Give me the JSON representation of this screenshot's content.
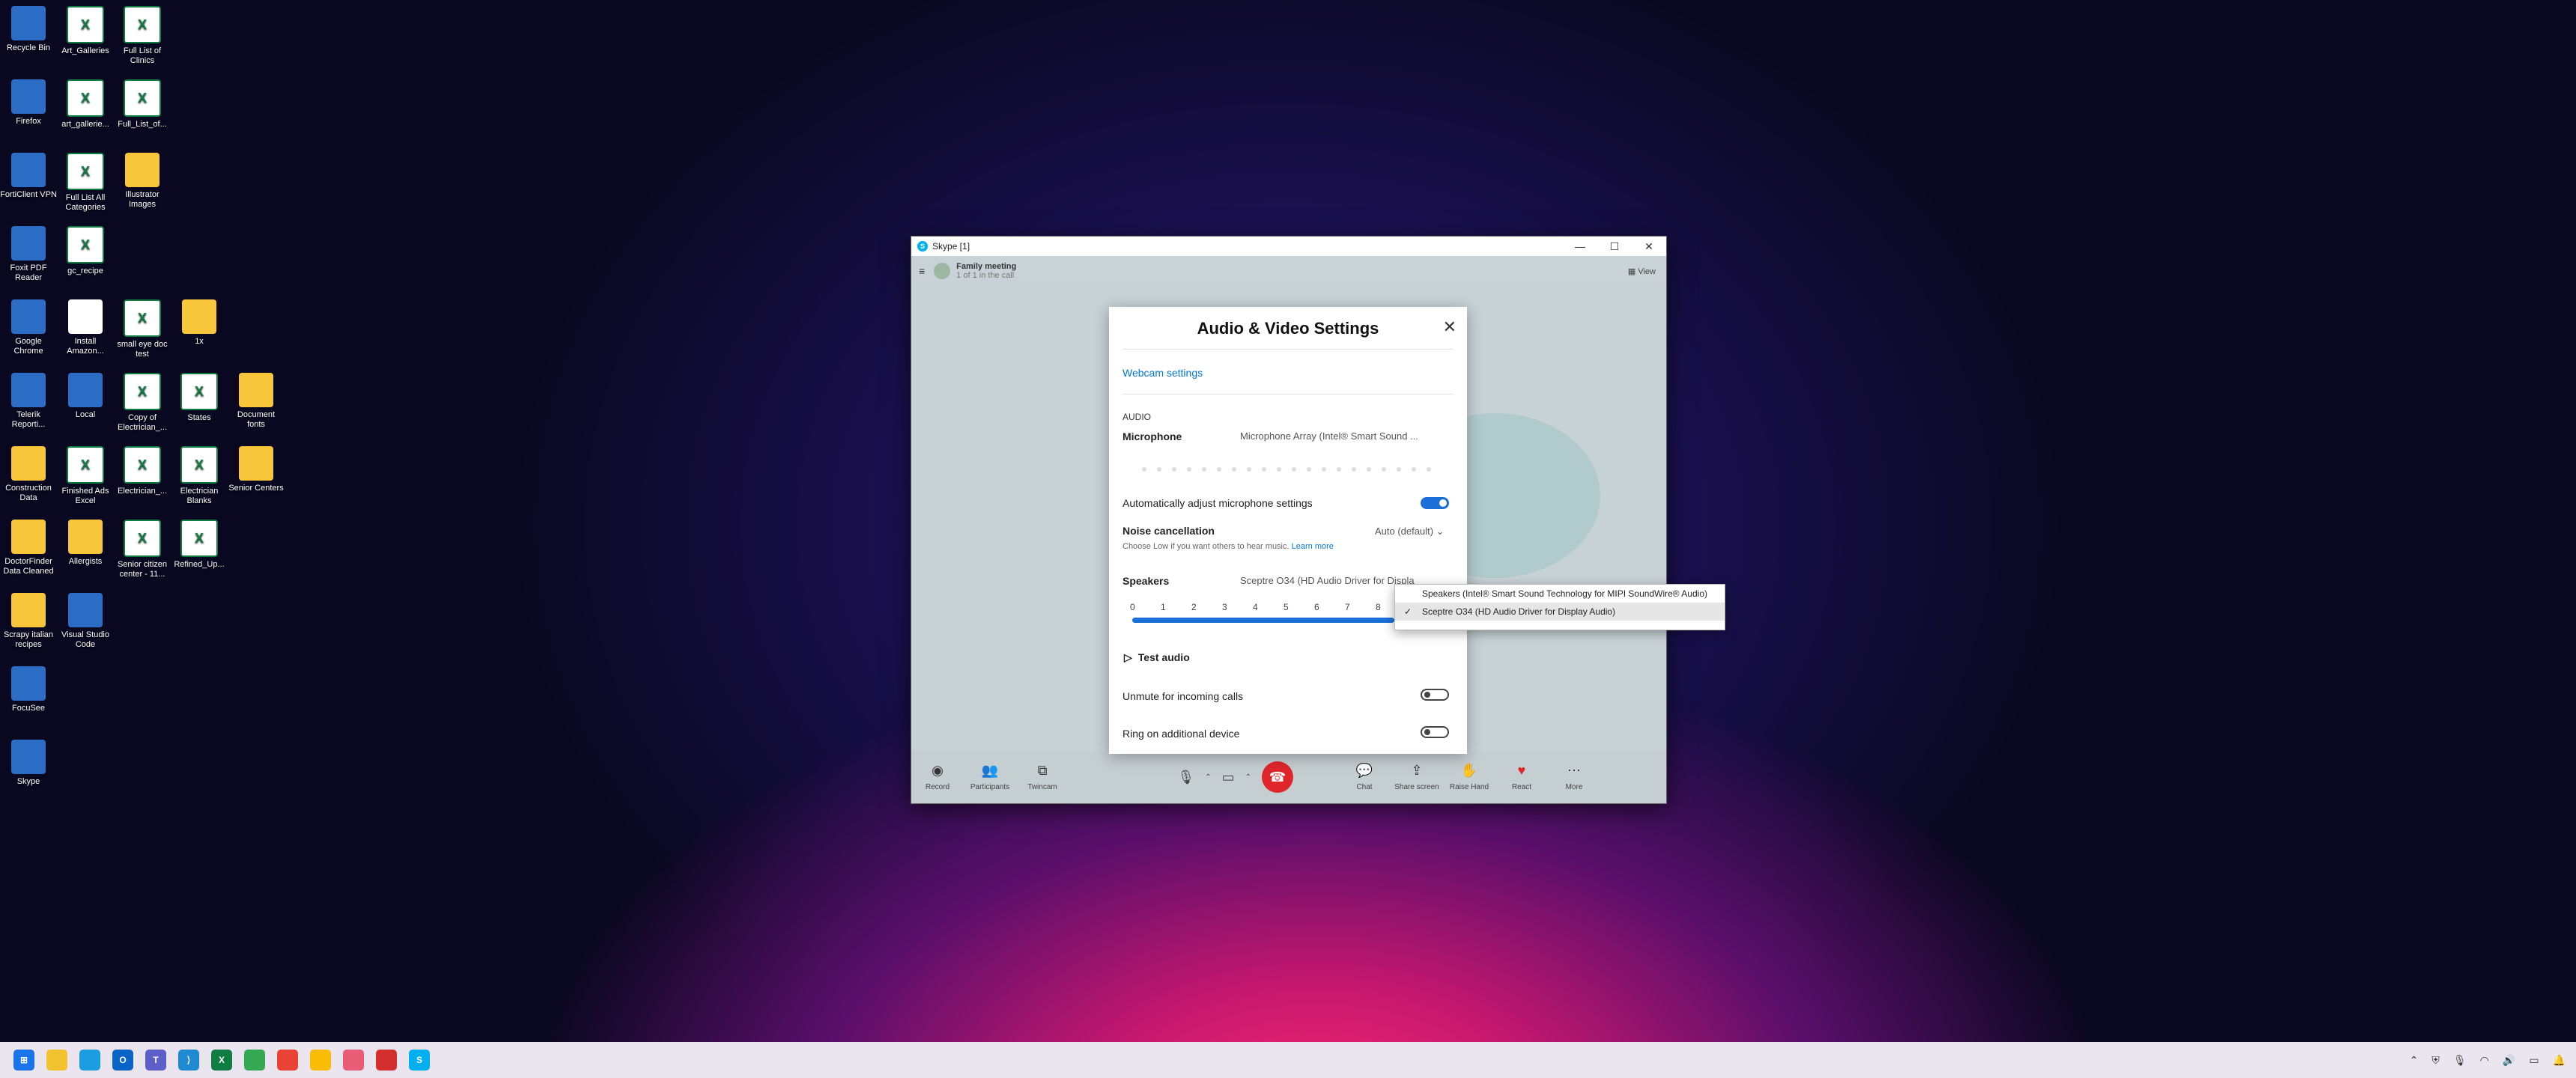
{
  "desktop_icons": [
    {
      "label": "Recycle Bin",
      "icon": "recycle-bin-icon",
      "kind": "app"
    },
    {
      "label": "Art_Galleries",
      "icon": "excel-icon",
      "kind": "excel"
    },
    {
      "label": "Full List of Clinics",
      "icon": "excel-icon",
      "kind": "excel"
    },
    {
      "label": "Firefox",
      "icon": "firefox-icon",
      "kind": "app"
    },
    {
      "label": "art_gallerie...",
      "icon": "excel-icon",
      "kind": "excel"
    },
    {
      "label": "Full_List_of...",
      "icon": "excel-icon",
      "kind": "excel"
    },
    {
      "label": "FortiClient VPN",
      "icon": "forticlient-icon",
      "kind": "app"
    },
    {
      "label": "Full List All Categories",
      "icon": "excel-icon",
      "kind": "excel"
    },
    {
      "label": "Illustrator Images",
      "icon": "folder-icon",
      "kind": "folder"
    },
    {
      "label": "Foxit PDF Reader",
      "icon": "foxit-icon",
      "kind": "app"
    },
    {
      "label": "gc_recipe",
      "icon": "excel-icon",
      "kind": "excel"
    },
    {
      "label": "Google Chrome",
      "icon": "chrome-icon",
      "kind": "app"
    },
    {
      "label": "Install Amazon...",
      "icon": "file-icon",
      "kind": "file"
    },
    {
      "label": "small eye doc test",
      "icon": "excel-icon",
      "kind": "excel"
    },
    {
      "label": "1x",
      "icon": "folder-icon",
      "kind": "folder"
    },
    {
      "label": "Telerik Reporti...",
      "icon": "telerik-icon",
      "kind": "app"
    },
    {
      "label": "Local",
      "icon": "local-icon",
      "kind": "app"
    },
    {
      "label": "Copy of Electrician_...",
      "icon": "excel-icon",
      "kind": "excel"
    },
    {
      "label": "States",
      "icon": "excel-icon",
      "kind": "excel"
    },
    {
      "label": "Document fonts",
      "icon": "folder-icon",
      "kind": "folder"
    },
    {
      "label": "Construction Data",
      "icon": "folder-icon",
      "kind": "folder"
    },
    {
      "label": "Finished Ads Excel",
      "icon": "excel-icon",
      "kind": "excel"
    },
    {
      "label": "Electrician_...",
      "icon": "excel-icon",
      "kind": "excel"
    },
    {
      "label": "Electrician Blanks",
      "icon": "excel-icon",
      "kind": "excel"
    },
    {
      "label": "Senior Centers",
      "icon": "folder-icon",
      "kind": "folder"
    },
    {
      "label": "DoctorFinder Data Cleaned",
      "icon": "folder-icon",
      "kind": "folder"
    },
    {
      "label": "Allergists",
      "icon": "folder-icon",
      "kind": "folder"
    },
    {
      "label": "Senior citizen center - 11...",
      "icon": "excel-icon",
      "kind": "excel"
    },
    {
      "label": "Refined_Up...",
      "icon": "excel-icon",
      "kind": "excel"
    },
    {
      "label": "Scrapy italian recipes",
      "icon": "folder-icon",
      "kind": "folder"
    },
    {
      "label": "Visual Studio Code",
      "icon": "vscode-icon",
      "kind": "app"
    },
    {
      "label": "FocuSee",
      "icon": "focusee-icon",
      "kind": "app"
    },
    {
      "label": "Skype",
      "icon": "skype-icon",
      "kind": "app"
    }
  ],
  "window": {
    "title": "Skype [1]"
  },
  "call": {
    "name": "Family meeting",
    "subtitle": "1 of 1 in the call",
    "view_label": "View",
    "toolbar": {
      "record": "Record",
      "participants": "Participants",
      "twincam": "Twincam",
      "chat": "Chat",
      "share_screen": "Share screen",
      "raise_hand": "Raise Hand",
      "react": "React",
      "more": "More"
    }
  },
  "settings": {
    "title": "Audio & Video Settings",
    "webcam_link": "Webcam settings",
    "audio_section": "AUDIO",
    "microphone_label": "Microphone",
    "microphone_value": "Microphone Array (Intel® Smart Sound ...",
    "auto_adjust_label": "Automatically adjust microphone settings",
    "auto_adjust_on": true,
    "noise_label": "Noise cancellation",
    "noise_value": "Auto (default)",
    "noise_help": "Choose Low if you want others to hear music.",
    "learn_more": "Learn more",
    "speakers_label": "Speakers",
    "speakers_value": "Sceptre O34 (HD Audio Driver for Displa",
    "volume_ticks": [
      "0",
      "1",
      "2",
      "3",
      "4",
      "5",
      "6",
      "7",
      "8"
    ],
    "test_audio": "Test audio",
    "unmute_label": "Unmute for incoming calls",
    "unmute_on": false,
    "ring_label": "Ring on additional device",
    "ring_on": false
  },
  "speaker_dropdown": {
    "options": [
      {
        "label": "Speakers (Intel® Smart Sound Technology for MIPI SoundWire® Audio)",
        "selected": false
      },
      {
        "label": "Sceptre O34 (HD Audio Driver for Display Audio)",
        "selected": true
      }
    ]
  },
  "colors": {
    "accent": "#1b6fd8",
    "link": "#0078d4",
    "end_call": "#e0262b"
  }
}
